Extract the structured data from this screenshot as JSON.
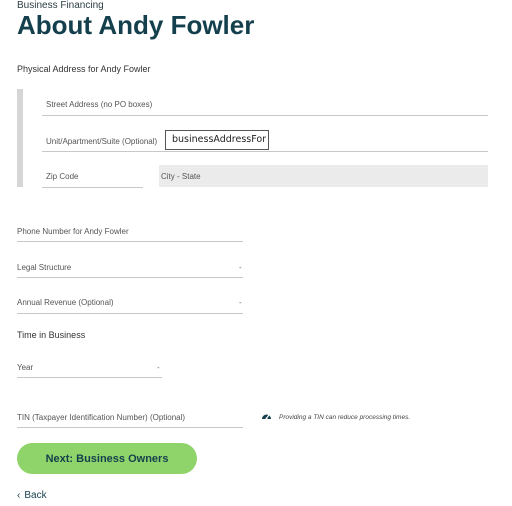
{
  "header": {
    "eyebrow": "Business Financing",
    "title": "About Andy Fowler"
  },
  "address": {
    "section_label": "Physical Address for Andy Fowler",
    "street_label": "Street Address (no PO boxes)",
    "unit_label": "Unit/Apartment/Suite (Optional)",
    "unit_value": "businessAddressFor",
    "zip_label": "Zip Code",
    "city_state_label": "City - State"
  },
  "phone": {
    "label": "Phone Number for Andy Fowler"
  },
  "legal_structure": {
    "label": "Legal Structure",
    "caret": "-"
  },
  "annual_revenue": {
    "label": "Annual Revenue (Optional)",
    "caret": "-"
  },
  "time_in_business": {
    "heading": "Time in Business",
    "year_label": "Year",
    "caret": "-"
  },
  "tin": {
    "label": "TIN (Taxpayer Identification Number) (Optional)",
    "note": "Providing a TIN can reduce processing times.",
    "icon": "speedometer-icon"
  },
  "actions": {
    "next_label": "Next: Business Owners",
    "back_label": "Back"
  },
  "colors": {
    "title": "#143f4c",
    "button": "#8fd46b",
    "field_fill": "#ebebeb",
    "underline": "#c8c8c8"
  }
}
